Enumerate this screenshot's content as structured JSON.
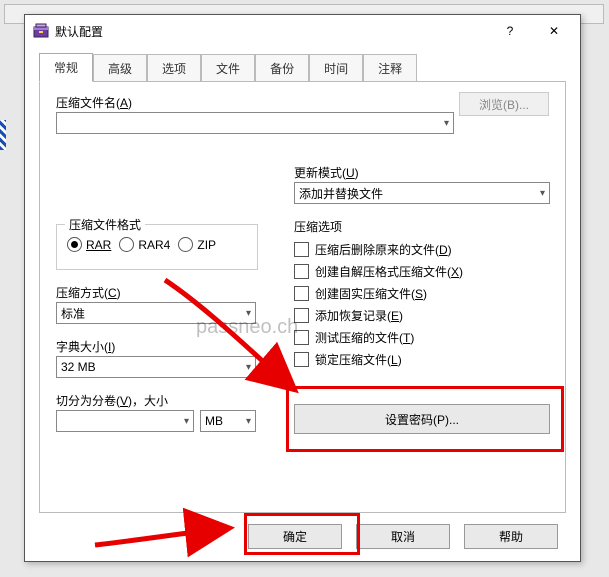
{
  "title": "默认配置",
  "help_glyph": "?",
  "close_glyph": "✕",
  "tabs": [
    "常规",
    "高级",
    "选项",
    "文件",
    "备份",
    "时间",
    "注释"
  ],
  "active_tab": 0,
  "archive_name": {
    "label_pre": "压缩文件名(",
    "hot": "A",
    "label_post": ")",
    "value": ""
  },
  "browse": {
    "label": "浏览(B)..."
  },
  "update_mode": {
    "label_pre": "更新模式(",
    "hot": "U",
    "label_post": ")",
    "value": "添加并替换文件"
  },
  "format_group": {
    "legend": "压缩文件格式",
    "options": [
      "RAR",
      "RAR4",
      "ZIP"
    ],
    "selected": 0
  },
  "method": {
    "label_pre": "压缩方式(",
    "hot": "C",
    "label_post": ")",
    "value": "标准"
  },
  "dict": {
    "label_pre": "字典大小(",
    "hot": "I",
    "label_post": ")",
    "value": "32 MB"
  },
  "split": {
    "label_pre": "切分为分卷(",
    "hot": "V",
    "label_post": ")，大小",
    "value": "",
    "unit": "MB"
  },
  "options": {
    "legend": "压缩选项",
    "items": [
      {
        "pre": "压缩后删除原来的文件(",
        "hot": "D",
        "post": ")"
      },
      {
        "pre": "创建自解压格式压缩文件(",
        "hot": "X",
        "post": ")"
      },
      {
        "pre": "创建固实压缩文件(",
        "hot": "S",
        "post": ")"
      },
      {
        "pre": "添加恢复记录(",
        "hot": "E",
        "post": ")"
      },
      {
        "pre": "测试压缩的文件(",
        "hot": "T",
        "post": ")"
      },
      {
        "pre": "锁定压缩文件(",
        "hot": "L",
        "post": ")"
      }
    ]
  },
  "set_password": {
    "label": "设置密码(P)..."
  },
  "buttons": {
    "ok": "确定",
    "cancel": "取消",
    "help": "帮助"
  },
  "watermark": "passneo.ch"
}
